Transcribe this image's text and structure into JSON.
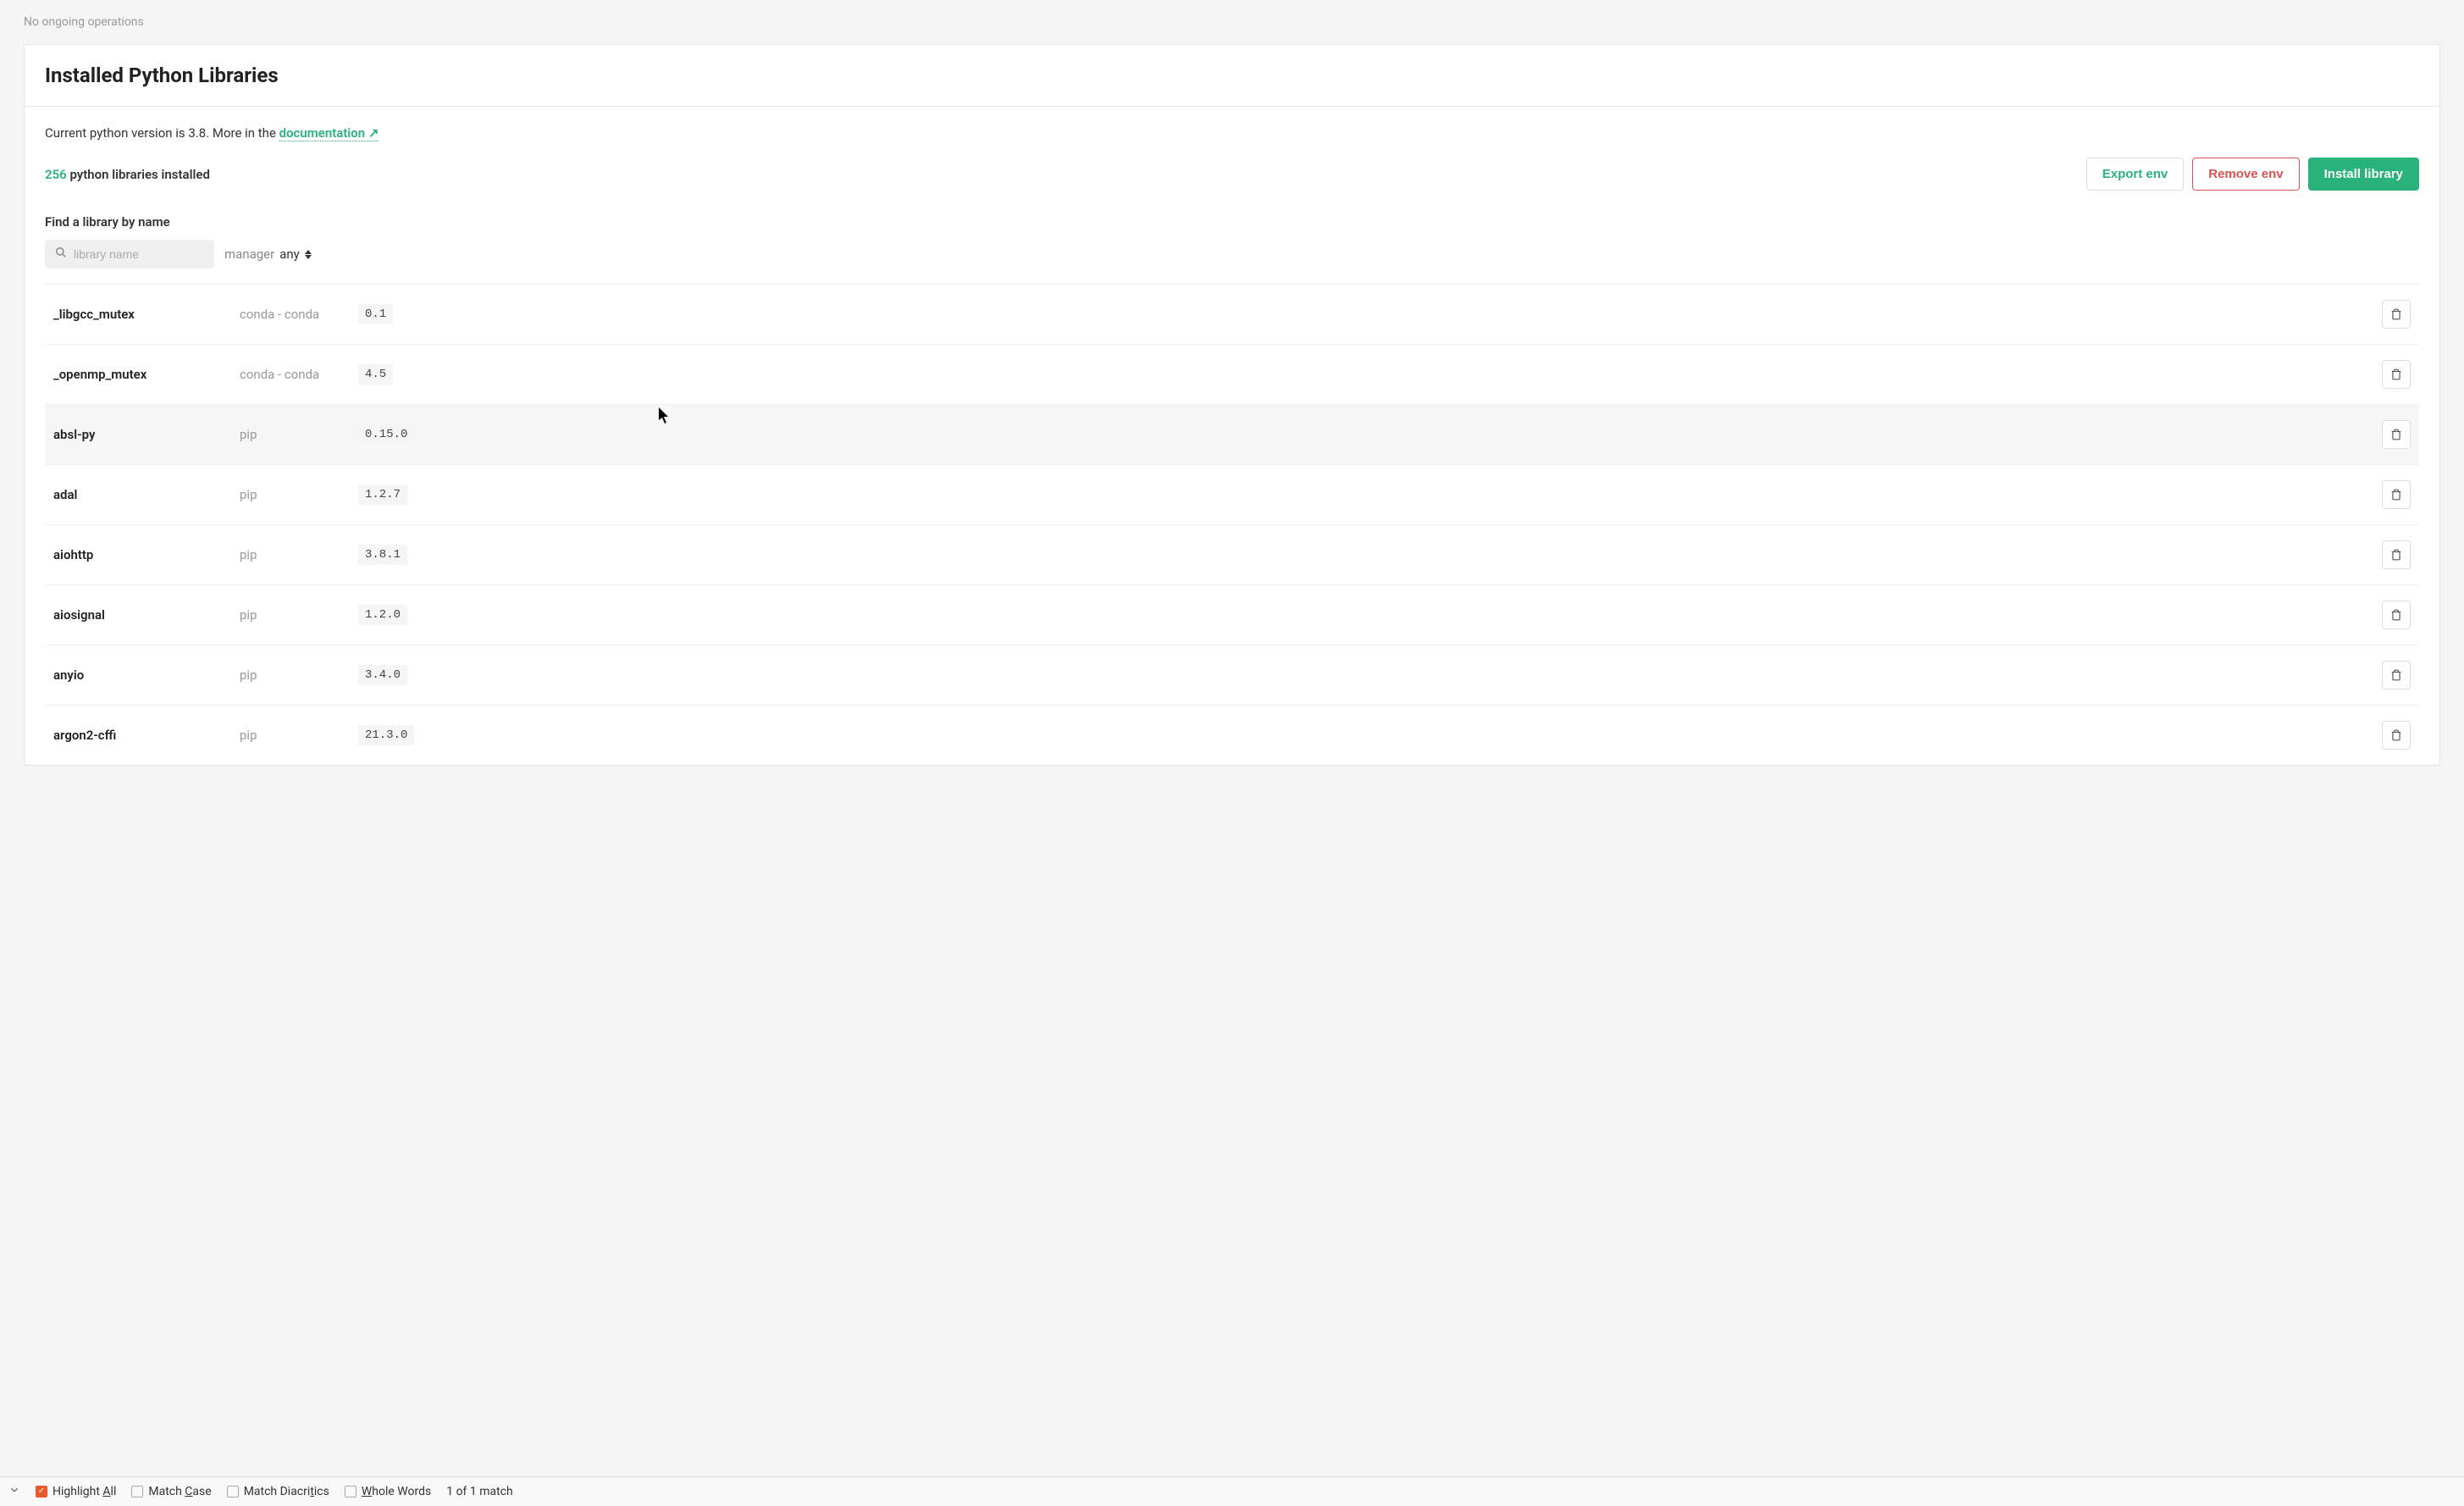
{
  "status_bar": {
    "text": "No ongoing operations"
  },
  "panel": {
    "title": "Installed Python Libraries",
    "info_prefix": "Current python version is 3.8. More in the ",
    "doc_link": "documentation",
    "library_count": "256",
    "library_count_suffix": " python libraries installed"
  },
  "buttons": {
    "export": "Export env",
    "remove": "Remove env",
    "install": "Install library"
  },
  "search": {
    "label": "Find a library by name",
    "placeholder": "library name",
    "manager_label": "manager",
    "manager_value": "any"
  },
  "libraries": [
    {
      "name": "_libgcc_mutex",
      "manager": "conda - conda",
      "version": "0.1",
      "hovered": false
    },
    {
      "name": "_openmp_mutex",
      "manager": "conda - conda",
      "version": "4.5",
      "hovered": false
    },
    {
      "name": "absl-py",
      "manager": "pip",
      "version": "0.15.0",
      "hovered": true
    },
    {
      "name": "adal",
      "manager": "pip",
      "version": "1.2.7",
      "hovered": false
    },
    {
      "name": "aiohttp",
      "manager": "pip",
      "version": "3.8.1",
      "hovered": false
    },
    {
      "name": "aiosignal",
      "manager": "pip",
      "version": "1.2.0",
      "hovered": false
    },
    {
      "name": "anyio",
      "manager": "pip",
      "version": "3.4.0",
      "hovered": false
    },
    {
      "name": "argon2-cffi",
      "manager": "pip",
      "version": "21.3.0",
      "hovered": false
    }
  ],
  "find_bar": {
    "highlight_all": "Highlight All",
    "match_case": "Match Case",
    "match_diacritics": "Match Diacritics",
    "whole_words": "hole Words",
    "whole_words_prefix": "W",
    "highlight_all_prefix": "Highlight ",
    "highlight_all_underline": "A",
    "highlight_all_suffix": "ll",
    "match_case_prefix": "Match ",
    "match_case_underline": "C",
    "match_case_suffix": "ase",
    "match_diacritics_prefix": "Match Diacri",
    "match_diacritics_underline": "t",
    "match_diacritics_suffix": "ics",
    "match_count": "1 of 1 match"
  }
}
